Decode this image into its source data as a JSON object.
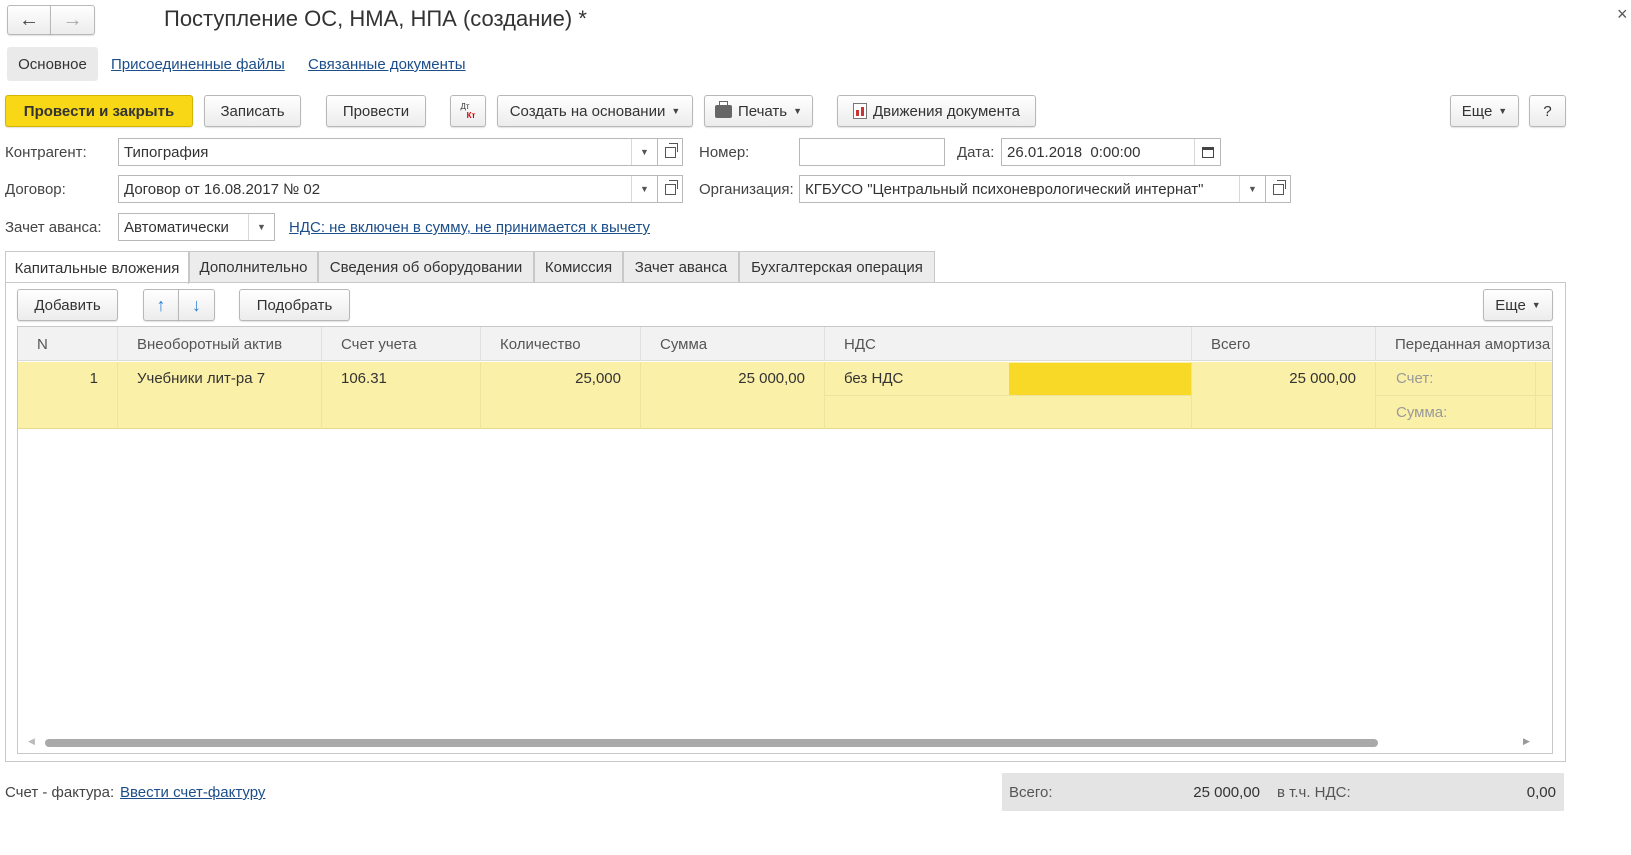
{
  "title": "Поступление ОС, НМА, НПА (создание) *",
  "close_glyph": "×",
  "nav": {
    "back": "←",
    "forward": "→"
  },
  "section_tabs": [
    "Основное",
    "Присоединенные файлы",
    "Связанные документы"
  ],
  "toolbar": {
    "post_close": "Провести и закрыть",
    "save": "Записать",
    "post": "Провести",
    "dtkt_top": "Дт",
    "dtkt_bottom": "Кт",
    "create_based": "Создать на основании",
    "print": "Печать",
    "movements": "Движения документа",
    "more": "Еще",
    "help": "?"
  },
  "form": {
    "contractor_label": "Контрагент:",
    "contractor_value": "Типография",
    "number_label": "Номер:",
    "number_value": "",
    "date_label": "Дата:",
    "date_value": "26.01.2018  0:00:00",
    "contract_label": "Договор:",
    "contract_value": "Договор от 16.08.2017 № 02",
    "org_label": "Организация:",
    "org_value": "КГБУСО \"Центральный психоневрологический интернат\"",
    "advance_label": "Зачет аванса:",
    "advance_value": "Автоматически",
    "vat_link": "НДС: не включен в сумму, не принимается к вычету"
  },
  "doc_tabs": [
    "Капитальные вложения",
    "Дополнительно",
    "Сведения об оборудовании",
    "Комиссия",
    "Зачет аванса",
    "Бухгалтерская операция"
  ],
  "table_toolbar": {
    "add": "Добавить",
    "pick": "Подобрать",
    "more": "Еще"
  },
  "table": {
    "headers": [
      "N",
      "Внеоборотный актив",
      "Счет учета",
      "Количество",
      "Сумма",
      "НДС",
      "Всего",
      "Переданная амортиза"
    ],
    "rows": [
      {
        "n": "1",
        "asset": "Учебники лит-ра 7",
        "account": "106.31",
        "qty": "25,000",
        "sum": "25 000,00",
        "vat": "без НДС",
        "total": "25 000,00",
        "amort_account_label": "Счет:",
        "amort_sum_label": "Сумма:"
      }
    ]
  },
  "footer": {
    "invoice_label": "Счет - фактура:",
    "invoice_link": "Ввести счет-фактуру",
    "total_label": "Всего:",
    "total_value": "25 000,00",
    "vat_label": "в т.ч. НДС:",
    "vat_value": "0,00"
  },
  "colors": {
    "accent": "#f7d716",
    "row_highlight": "#fbf0a8",
    "cell_active": "#f8d927",
    "link": "#1c4e8a"
  }
}
